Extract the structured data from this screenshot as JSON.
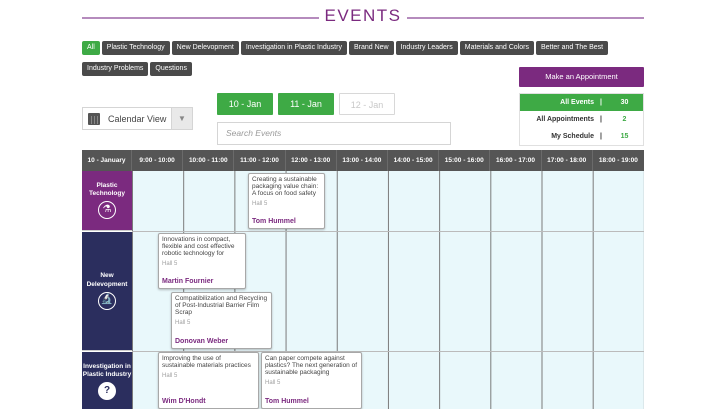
{
  "header": {
    "title": "EVENTS"
  },
  "categories": [
    {
      "label": "All",
      "active": true
    },
    {
      "label": "Plastic Technology",
      "active": false
    },
    {
      "label": "New Delevopment",
      "active": false
    },
    {
      "label": "Investigation in Plastic Industry",
      "active": false
    },
    {
      "label": "Brand New",
      "active": false
    },
    {
      "label": "Industry Leaders",
      "active": false
    },
    {
      "label": "Materials and Colors",
      "active": false
    },
    {
      "label": "Better and The Best",
      "active": false
    },
    {
      "label": "Industry Problems",
      "active": false
    },
    {
      "label": "Questions",
      "active": false
    }
  ],
  "appointment_button": "Make an Appointment",
  "stats": [
    {
      "label": "All Events",
      "sep": "|",
      "value": "30"
    },
    {
      "label": "All Appointments",
      "sep": "|",
      "value": "2"
    },
    {
      "label": "My Schedule",
      "sep": "|",
      "value": "15"
    }
  ],
  "view": {
    "label": "Calendar View",
    "icon": "calendar-icon"
  },
  "dates": [
    {
      "label": "10 - Jan",
      "state": "on"
    },
    {
      "label": "11 - Jan",
      "state": "on"
    },
    {
      "label": "12 - Jan",
      "state": "off"
    }
  ],
  "search": {
    "placeholder": "Search Events"
  },
  "schedule": {
    "corner": "10 - January",
    "slots": [
      "9:00 - 10:00",
      "10:00 - 11:00",
      "11:00 - 12:00",
      "12:00 - 13:00",
      "13:00 - 14:00",
      "14:00 - 15:00",
      "15:00 - 16:00",
      "16:00 - 17:00",
      "17:00 - 18:00",
      "18:00 - 19:00"
    ],
    "rows": [
      {
        "label": "Plastic Technology",
        "icon": "lab-flask-icon",
        "color": "purple"
      },
      {
        "label": "New Delevopment",
        "icon": "microscope-icon",
        "color": "navy"
      },
      {
        "label": "Investigation in Plastic Industry",
        "icon": "question-icon",
        "color": "navy"
      }
    ],
    "events": [
      {
        "title": "Creating a sustainable packaging value chain: A focus on food safety",
        "hall": "Hall 5",
        "speaker": "Tom Hummel"
      },
      {
        "title": "Innovations in compact, flexible and cost effective robotic technology for",
        "hall": "Hall 5",
        "speaker": "Martin Fournier"
      },
      {
        "title": "Compatibilization and Recycling of Post-Industrial Barrier Film Scrap",
        "hall": "Hall 5",
        "speaker": "Donovan Weber"
      },
      {
        "title": "Improving the use of sustainable materials practices",
        "hall": "Hall 5",
        "speaker": "Wim D'Hondt"
      },
      {
        "title": "Can paper compete against plastics? The next generation of sustainable packaging",
        "hall": "Hall 5",
        "speaker": "Tom Hummel"
      }
    ]
  },
  "colors": {
    "purple": "#7b2a7f",
    "green": "#3eaa45",
    "navy": "#2b2e5e",
    "dark": "#4a4a4a"
  }
}
